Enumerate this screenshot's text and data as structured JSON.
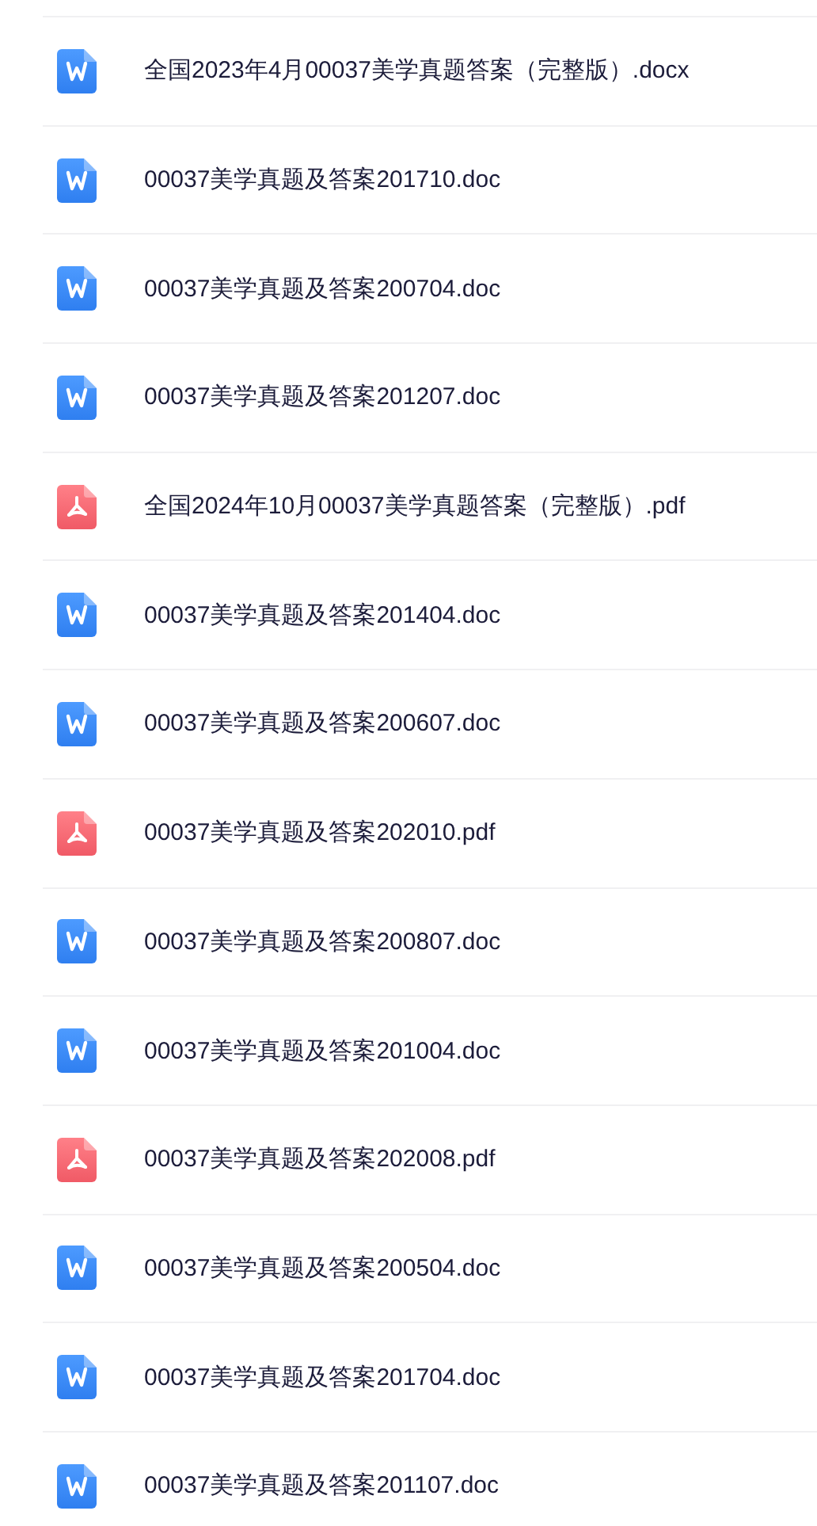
{
  "files": [
    {
      "kind": "word",
      "name": "全国2023年4月00037美学真题答案（完整版）.docx"
    },
    {
      "kind": "word",
      "name": "00037美学真题及答案201710.doc"
    },
    {
      "kind": "word",
      "name": "00037美学真题及答案200704.doc"
    },
    {
      "kind": "word",
      "name": "00037美学真题及答案201207.doc"
    },
    {
      "kind": "pdf",
      "name": "全国2024年10月00037美学真题答案（完整版）.pdf"
    },
    {
      "kind": "word",
      "name": "00037美学真题及答案201404.doc"
    },
    {
      "kind": "word",
      "name": "00037美学真题及答案200607.doc"
    },
    {
      "kind": "pdf",
      "name": "00037美学真题及答案202010.pdf"
    },
    {
      "kind": "word",
      "name": "00037美学真题及答案200807.doc"
    },
    {
      "kind": "word",
      "name": "00037美学真题及答案201004.doc"
    },
    {
      "kind": "pdf",
      "name": "00037美学真题及答案202008.pdf"
    },
    {
      "kind": "word",
      "name": "00037美学真题及答案200504.doc"
    },
    {
      "kind": "word",
      "name": "00037美学真题及答案201704.doc"
    },
    {
      "kind": "word",
      "name": "00037美学真题及答案201107.doc"
    }
  ]
}
